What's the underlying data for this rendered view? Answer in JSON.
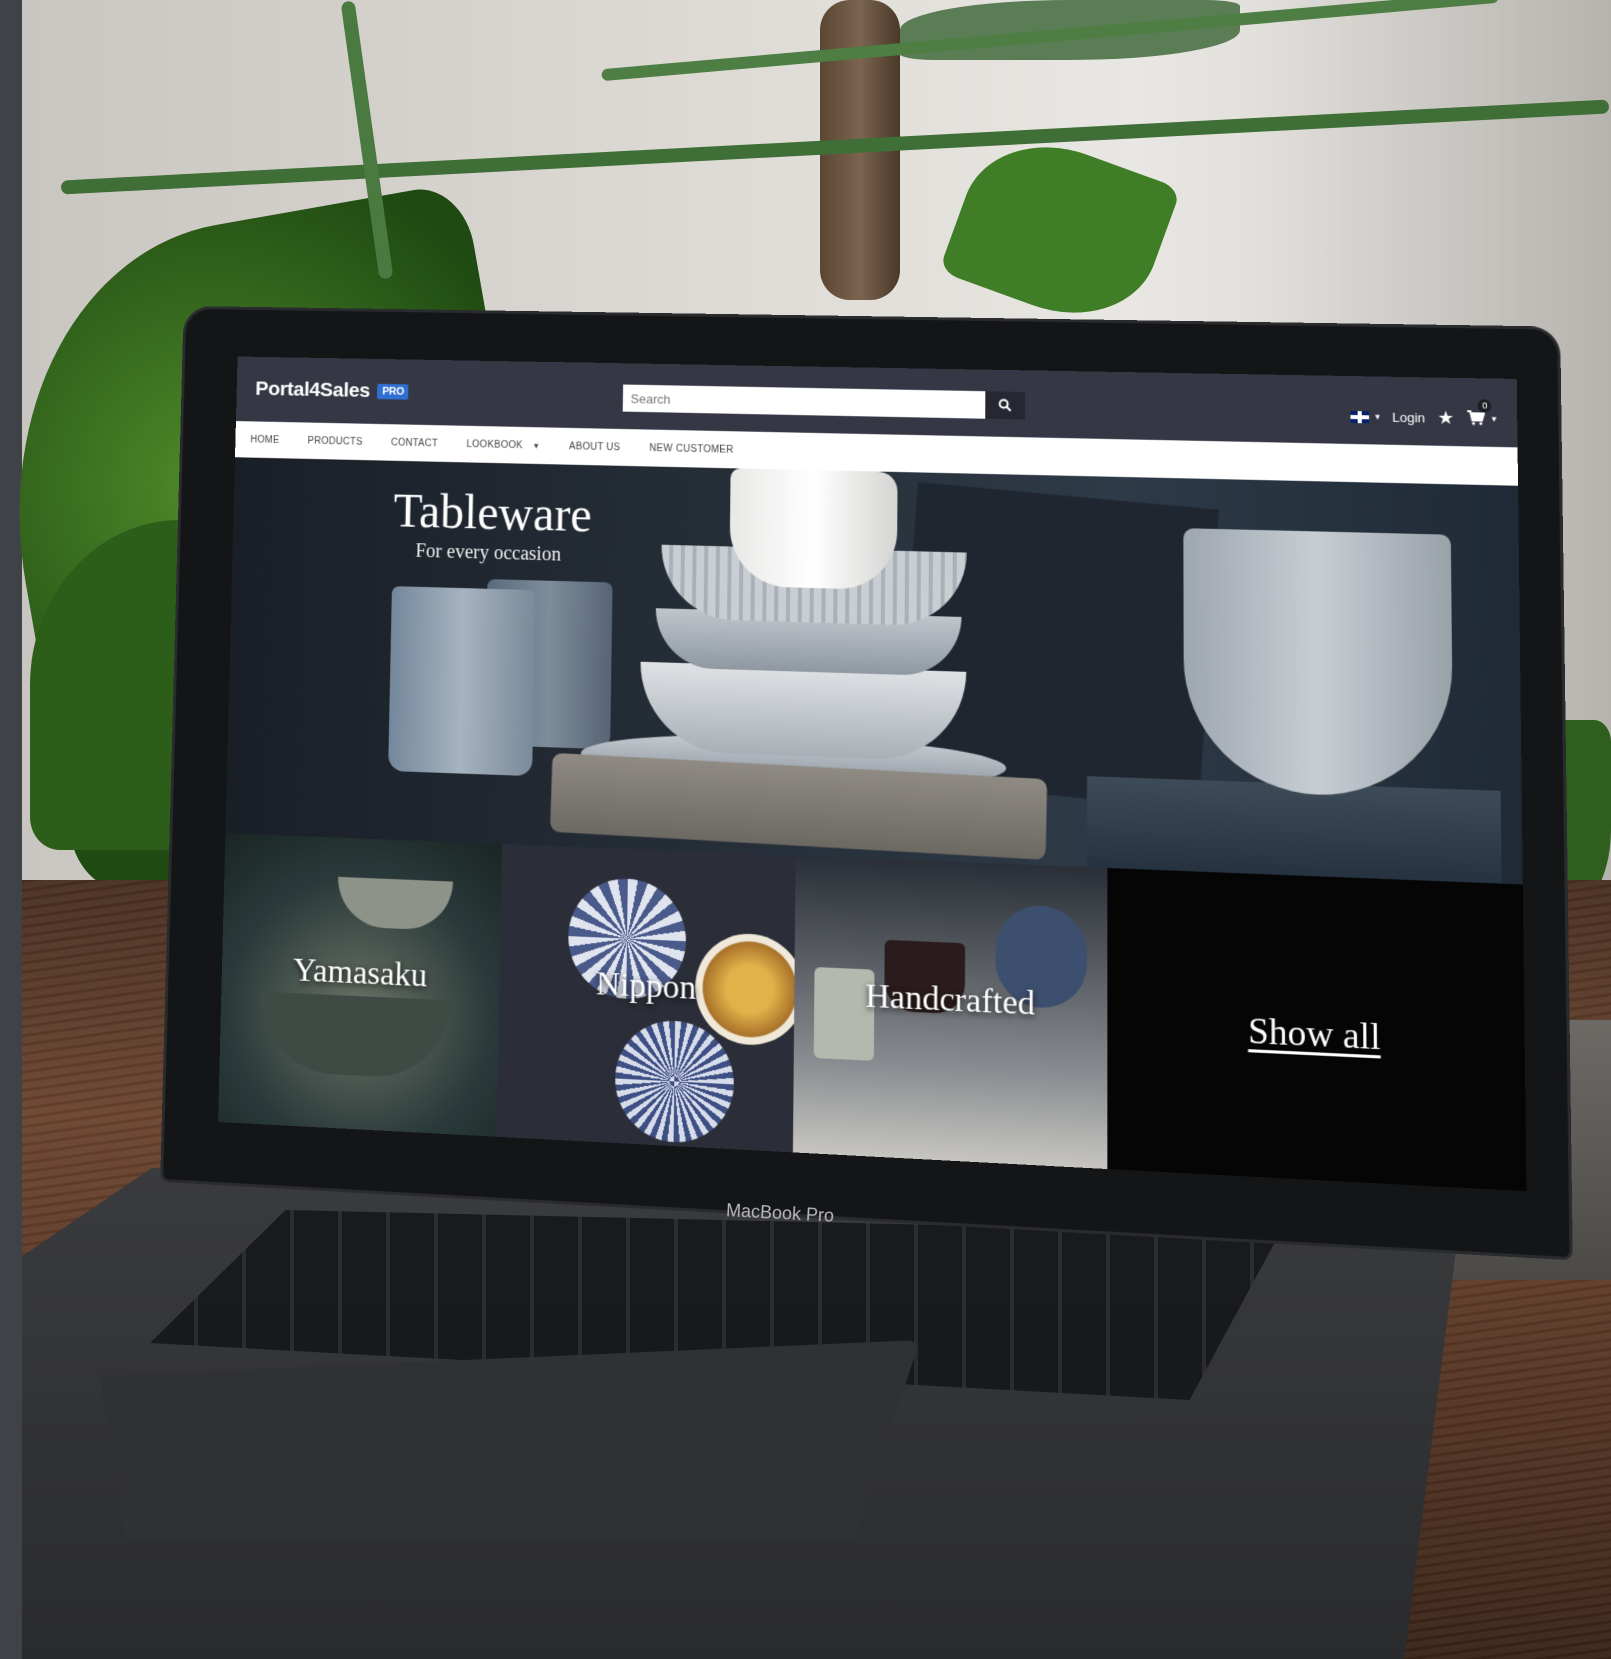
{
  "brand": {
    "name": "Portal4Sales",
    "badge": "PRO"
  },
  "search": {
    "placeholder": "Search",
    "icon": "search-icon"
  },
  "utility": {
    "language_icon": "uk-flag-icon",
    "login_label": "Login",
    "favorites_icon": "star-icon",
    "cart_icon": "cart-icon",
    "cart_count": "0"
  },
  "nav": {
    "items": [
      {
        "label": "HOME"
      },
      {
        "label": "PRODUCTS"
      },
      {
        "label": "CONTACT"
      },
      {
        "label": "LOOKBOOK"
      },
      {
        "label": "ABOUT US"
      },
      {
        "label": "NEW CUSTOMER"
      }
    ]
  },
  "hero": {
    "title": "Tableware",
    "subtitle": "For every occasion"
  },
  "tiles": [
    {
      "label": "Yamasaku"
    },
    {
      "label": "Nippon"
    },
    {
      "label": "Handcrafted"
    },
    {
      "label": "Show all"
    }
  ],
  "device_label": "MacBook Pro",
  "colors": {
    "header": "#353844",
    "badge_blue": "#2f6fd1",
    "nav_bg": "#ffffff"
  }
}
